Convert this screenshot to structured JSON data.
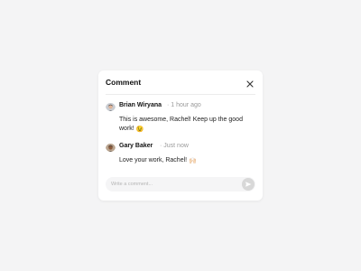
{
  "panel": {
    "title": "Comment",
    "close_icon": "close-icon"
  },
  "comments": [
    {
      "author": "Brian Wiryana",
      "time": "· 1 hour ago",
      "text": "This is awesome, Rachel! Keep up the good work!",
      "emoji": "😉"
    },
    {
      "author": "Gary Baker",
      "time": "· Just now",
      "text": "Love your work, Rachel!",
      "emoji": "🙌🏻"
    }
  ],
  "composer": {
    "placeholder": "Write a comment...",
    "send_icon": "send-icon"
  },
  "colors": {
    "background": "#f4f4f5",
    "card": "#ffffff",
    "muted_text": "#9a9a9a",
    "send_button": "#d8d8d8"
  }
}
